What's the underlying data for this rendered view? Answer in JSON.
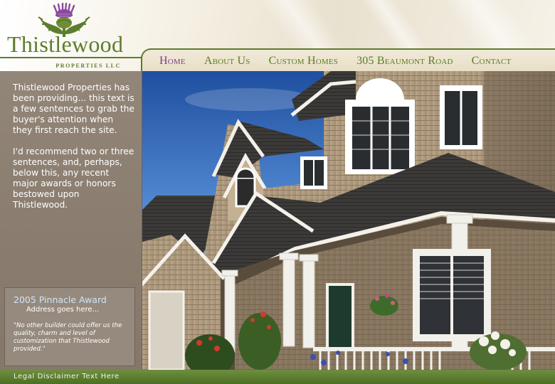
{
  "brand": {
    "name": "Thistlewood",
    "tagline": "PROPERTIES LLC",
    "colors": {
      "green": "#5d7d2e",
      "purple": "#7a3d8c",
      "sidebar": "#8a7d6f"
    }
  },
  "nav": {
    "items": [
      {
        "label": "Home",
        "active": true
      },
      {
        "label": "About Us"
      },
      {
        "label": "Custom Homes"
      },
      {
        "label": "305 Beaumont Road"
      },
      {
        "label": "Contact"
      }
    ]
  },
  "sidebar": {
    "intro_1": "Thistlewood Properties has been providing... this text is a few sentences to grab the buyer's attention when they first reach the site.",
    "intro_2": "I'd recommend two or three sentences, and, perhaps, below this, any recent major awards or honors bestowed upon Thistlewood."
  },
  "award": {
    "title": "2005 Pinnacle Award",
    "address": "Address goes here...",
    "quote": "\"No other builder could offer us the quality, charm and level of customization that Thistlewood provided.\""
  },
  "hero": {
    "icon": "house-photo"
  },
  "footer": {
    "legal": "Legal Disclaimer Text Here"
  }
}
